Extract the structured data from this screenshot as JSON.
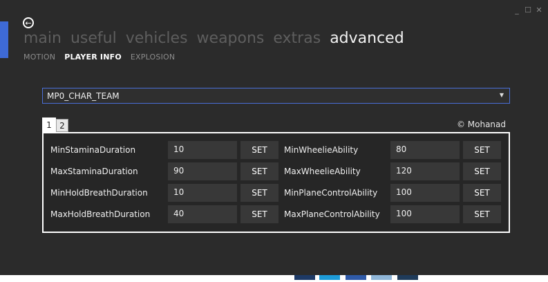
{
  "window_controls": {
    "minimize": "_",
    "maximize": "☐",
    "close": "✕"
  },
  "main_nav": [
    "main",
    "useful",
    "vehicles",
    "weapons",
    "extras",
    "advanced"
  ],
  "main_nav_active": "advanced",
  "sub_nav": [
    "MOTION",
    "PLAYER INFO",
    "EXPLOSION"
  ],
  "sub_nav_active": "PLAYER INFO",
  "stat_dropdown": {
    "value": "MP0_CHAR_TEAM"
  },
  "tabs": [
    "1",
    "2"
  ],
  "copyright": "© Mohanad",
  "set_label": "SET",
  "stats_left": [
    {
      "label": "MinStaminaDuration",
      "value": "10"
    },
    {
      "label": "MaxStaminaDuration",
      "value": "90"
    },
    {
      "label": "MinHoldBreathDuration",
      "value": "10"
    },
    {
      "label": "MaxHoldBreathDuration",
      "value": "40"
    }
  ],
  "stats_right": [
    {
      "label": "MinWheelieAbility",
      "value": "80"
    },
    {
      "label": "MaxWheelieAbility",
      "value": "120"
    },
    {
      "label": "MinPlaneControlAbility",
      "value": "100"
    },
    {
      "label": "MaxPlaneControlAbility",
      "value": "100"
    }
  ],
  "colors": {
    "accent": "#3e6ad6",
    "background": "#2b2b2b",
    "field": "#383838"
  }
}
